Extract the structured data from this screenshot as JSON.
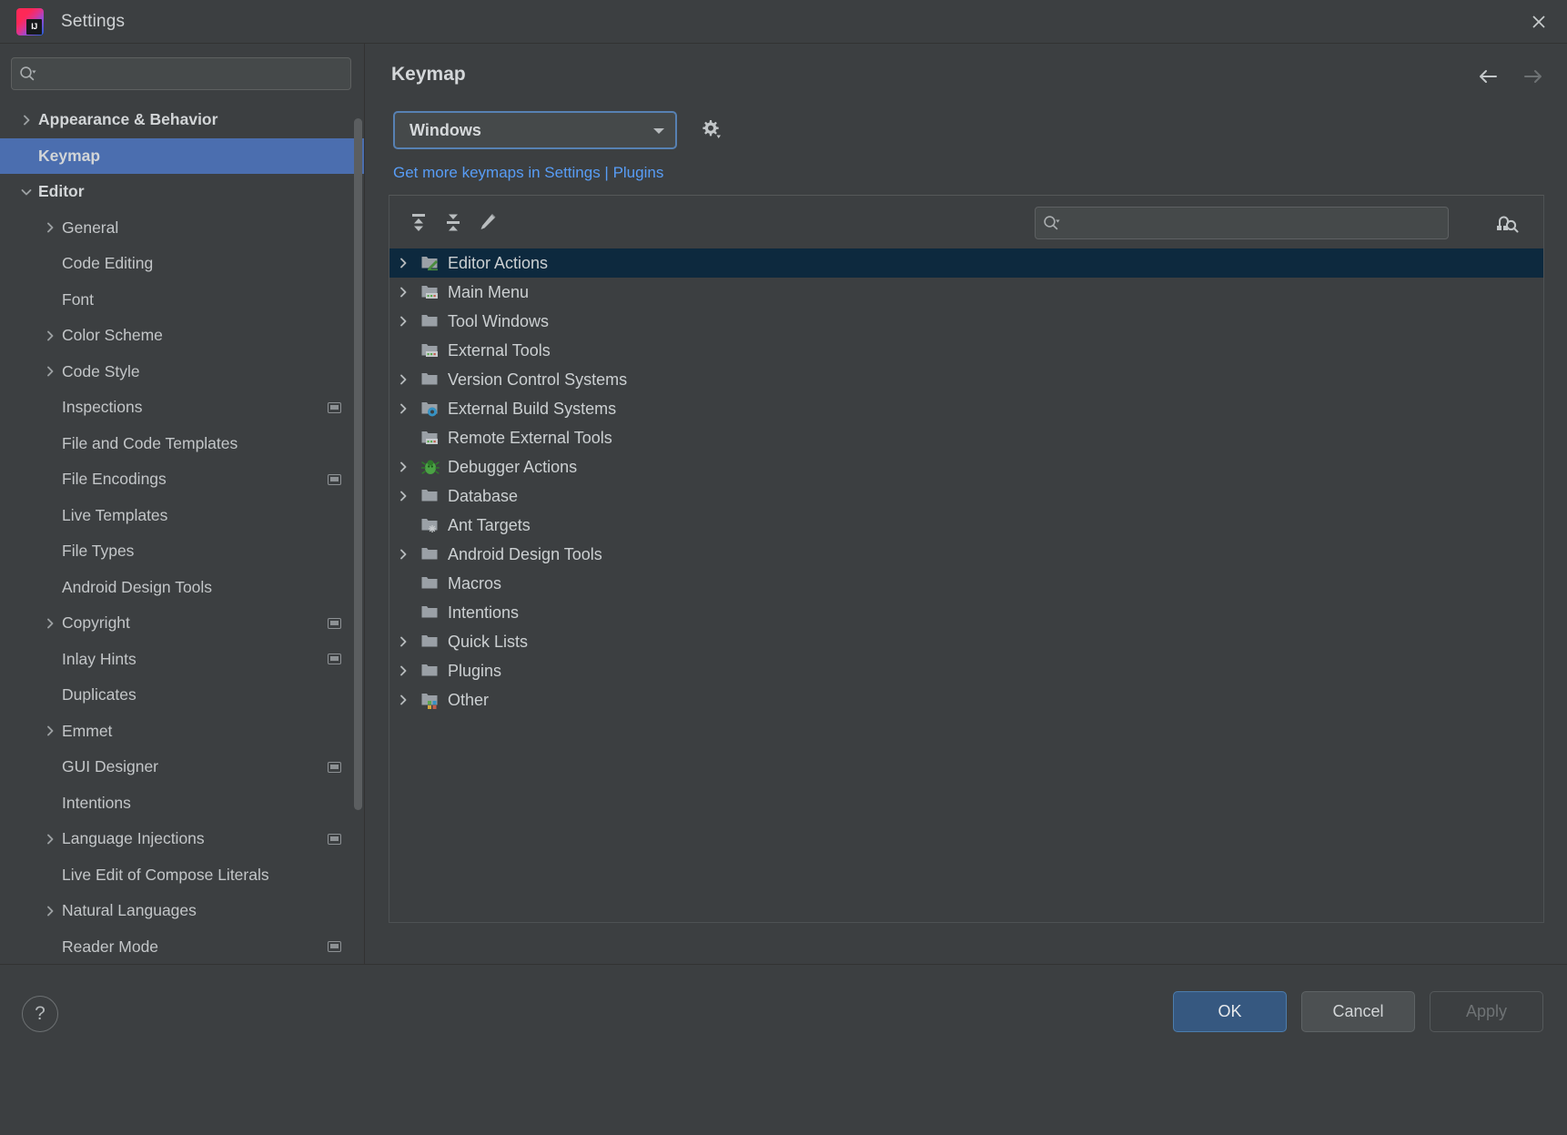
{
  "window": {
    "title": "Settings",
    "logo_text": "IJ",
    "close_icon": "close-icon"
  },
  "sidebar": {
    "search": {
      "placeholder": "",
      "value": "",
      "icon": "search-icon"
    },
    "items": [
      {
        "label": "Appearance & Behavior",
        "level": 0,
        "arrow": "chevron-right",
        "selected": false,
        "badge": false
      },
      {
        "label": "Keymap",
        "level": 0,
        "arrow": "",
        "selected": true,
        "badge": false
      },
      {
        "label": "Editor",
        "level": 0,
        "arrow": "chevron-down",
        "selected": false,
        "badge": false
      },
      {
        "label": "General",
        "level": 1,
        "arrow": "chevron-right",
        "selected": false,
        "badge": false
      },
      {
        "label": "Code Editing",
        "level": 1,
        "arrow": "",
        "selected": false,
        "badge": false
      },
      {
        "label": "Font",
        "level": 1,
        "arrow": "",
        "selected": false,
        "badge": false
      },
      {
        "label": "Color Scheme",
        "level": 1,
        "arrow": "chevron-right",
        "selected": false,
        "badge": false
      },
      {
        "label": "Code Style",
        "level": 1,
        "arrow": "chevron-right",
        "selected": false,
        "badge": false
      },
      {
        "label": "Inspections",
        "level": 1,
        "arrow": "",
        "selected": false,
        "badge": true
      },
      {
        "label": "File and Code Templates",
        "level": 1,
        "arrow": "",
        "selected": false,
        "badge": false
      },
      {
        "label": "File Encodings",
        "level": 1,
        "arrow": "",
        "selected": false,
        "badge": true
      },
      {
        "label": "Live Templates",
        "level": 1,
        "arrow": "",
        "selected": false,
        "badge": false
      },
      {
        "label": "File Types",
        "level": 1,
        "arrow": "",
        "selected": false,
        "badge": false
      },
      {
        "label": "Android Design Tools",
        "level": 1,
        "arrow": "",
        "selected": false,
        "badge": false
      },
      {
        "label": "Copyright",
        "level": 1,
        "arrow": "chevron-right",
        "selected": false,
        "badge": true
      },
      {
        "label": "Inlay Hints",
        "level": 1,
        "arrow": "",
        "selected": false,
        "badge": true
      },
      {
        "label": "Duplicates",
        "level": 1,
        "arrow": "",
        "selected": false,
        "badge": false
      },
      {
        "label": "Emmet",
        "level": 1,
        "arrow": "chevron-right",
        "selected": false,
        "badge": false
      },
      {
        "label": "GUI Designer",
        "level": 1,
        "arrow": "",
        "selected": false,
        "badge": true
      },
      {
        "label": "Intentions",
        "level": 1,
        "arrow": "",
        "selected": false,
        "badge": false
      },
      {
        "label": "Language Injections",
        "level": 1,
        "arrow": "chevron-right",
        "selected": false,
        "badge": true
      },
      {
        "label": "Live Edit of Compose Literals",
        "level": 1,
        "arrow": "",
        "selected": false,
        "badge": false
      },
      {
        "label": "Natural Languages",
        "level": 1,
        "arrow": "chevron-right",
        "selected": false,
        "badge": false
      },
      {
        "label": "Reader Mode",
        "level": 1,
        "arrow": "",
        "selected": false,
        "badge": true
      }
    ]
  },
  "main": {
    "title": "Keymap",
    "nav": {
      "back_icon": "arrow-left-icon",
      "forward_icon": "arrow-right-icon"
    },
    "keymap_select": {
      "value": "Windows",
      "options": [
        "Windows"
      ]
    },
    "gear_icon": "gear-icon",
    "link": "Get more keymaps in Settings | Plugins",
    "toolbar": {
      "expand_all_icon": "expand-all-icon",
      "collapse_all_icon": "collapse-all-icon",
      "edit_shortcut_icon": "pencil-icon",
      "find_by_shortcut_icon": "find-by-shortcut-icon"
    },
    "search": {
      "placeholder": "",
      "value": "",
      "icon": "search-icon"
    },
    "tree": [
      {
        "label": "Editor Actions",
        "arrow": "chevron-right",
        "icon": "folder-editor-icon",
        "selected": true
      },
      {
        "label": "Main Menu",
        "arrow": "chevron-right",
        "icon": "folder-menu-icon",
        "selected": false
      },
      {
        "label": "Tool Windows",
        "arrow": "chevron-right",
        "icon": "folder-icon",
        "selected": false
      },
      {
        "label": "External Tools",
        "arrow": "",
        "icon": "folder-tools-icon",
        "selected": false
      },
      {
        "label": "Version Control Systems",
        "arrow": "chevron-right",
        "icon": "folder-icon",
        "selected": false
      },
      {
        "label": "External Build Systems",
        "arrow": "chevron-right",
        "icon": "folder-build-icon",
        "selected": false
      },
      {
        "label": "Remote External Tools",
        "arrow": "",
        "icon": "folder-tools-icon",
        "selected": false
      },
      {
        "label": "Debugger Actions",
        "arrow": "chevron-right",
        "icon": "bug-icon",
        "selected": false
      },
      {
        "label": "Database",
        "arrow": "chevron-right",
        "icon": "folder-icon",
        "selected": false
      },
      {
        "label": "Ant Targets",
        "arrow": "",
        "icon": "folder-ant-icon",
        "selected": false
      },
      {
        "label": "Android Design Tools",
        "arrow": "chevron-right",
        "icon": "folder-icon",
        "selected": false
      },
      {
        "label": "Macros",
        "arrow": "",
        "icon": "folder-icon",
        "selected": false
      },
      {
        "label": "Intentions",
        "arrow": "",
        "icon": "folder-icon",
        "selected": false
      },
      {
        "label": "Quick Lists",
        "arrow": "chevron-right",
        "icon": "folder-icon",
        "selected": false
      },
      {
        "label": "Plugins",
        "arrow": "chevron-right",
        "icon": "folder-icon",
        "selected": false
      },
      {
        "label": "Other",
        "arrow": "chevron-right",
        "icon": "folder-other-icon",
        "selected": false
      }
    ]
  },
  "footer": {
    "help_label": "?",
    "ok_label": "OK",
    "cancel_label": "Cancel",
    "apply_label": "Apply"
  },
  "colors": {
    "accent_blue": "#4b6eaf",
    "link_blue": "#589df6",
    "selection_dark": "#0d293e",
    "panel_bg": "#3c3f41",
    "button_primary": "#365880"
  }
}
